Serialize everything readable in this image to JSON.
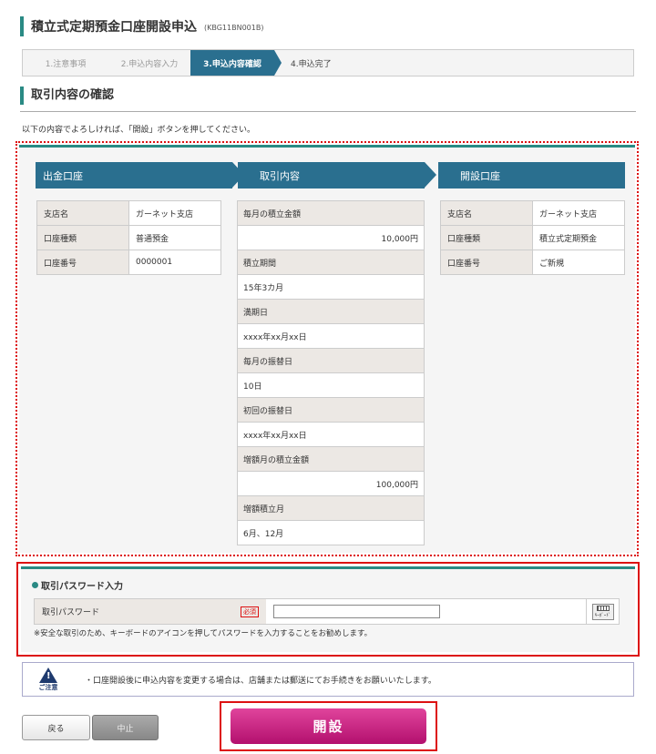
{
  "page": {
    "title": "積立式定期預金口座開設申込",
    "code": "(KBG11BN001B)"
  },
  "steps": [
    "1.注意事項",
    "2.申込内容入力",
    "3.申込内容確認",
    "4.申込完了"
  ],
  "section": {
    "title": "取引内容の確認",
    "instruction": "以下の内容でよろしければ、「開設」ボタンを押してください。"
  },
  "debit": {
    "header": "出金口座",
    "rows": [
      {
        "label": "支店名",
        "value": "ガーネット支店"
      },
      {
        "label": "口座種類",
        "value": "普通預金"
      },
      {
        "label": "口座番号",
        "value": "0000001"
      }
    ]
  },
  "transaction": {
    "header": "取引内容",
    "rows": [
      {
        "label": "毎月の積立金額",
        "value": "10,000円"
      },
      {
        "label": "積立期間",
        "value": "15年3カ月"
      },
      {
        "label": "満期日",
        "value": "xxxx年xx月xx日"
      },
      {
        "label": "毎月の振替日",
        "value": "10日"
      },
      {
        "label": "初回の振替日",
        "value": "xxxx年xx月xx日"
      },
      {
        "label": "増額月の積立金額",
        "value": "100,000円"
      },
      {
        "label": "増額積立月",
        "value": "6月、12月"
      }
    ]
  },
  "open_account": {
    "header": "開設口座",
    "rows": [
      {
        "label": "支店名",
        "value": "ガーネット支店"
      },
      {
        "label": "口座種類",
        "value": "積立式定期預金"
      },
      {
        "label": "口座番号",
        "value": "ご新規"
      }
    ]
  },
  "password": {
    "title": "取引パスワード入力",
    "label": "取引パスワード",
    "required": "必須",
    "value": "",
    "keyboard_icon_text": "ｷｰﾎﾞｰﾄﾞ",
    "note": "※安全な取引のため、キーボードのアイコンを押してパスワードを入力することをお勧めします。"
  },
  "caution": {
    "label": "ご注意",
    "text": "・口座開設後に申込内容を変更する場合は、店舗または郵送にてお手続きをお願いいたします。"
  },
  "buttons": {
    "back": "戻る",
    "cancel": "中止",
    "open": "開設"
  },
  "colors": {
    "accent": "#2a8a84",
    "header_blue": "#2a6f8f",
    "primary_button": "#c8207f",
    "highlight_border": "#dd1111"
  },
  "icons": {
    "caution": "warning-triangle-icon",
    "keyboard": "keyboard-icon"
  }
}
